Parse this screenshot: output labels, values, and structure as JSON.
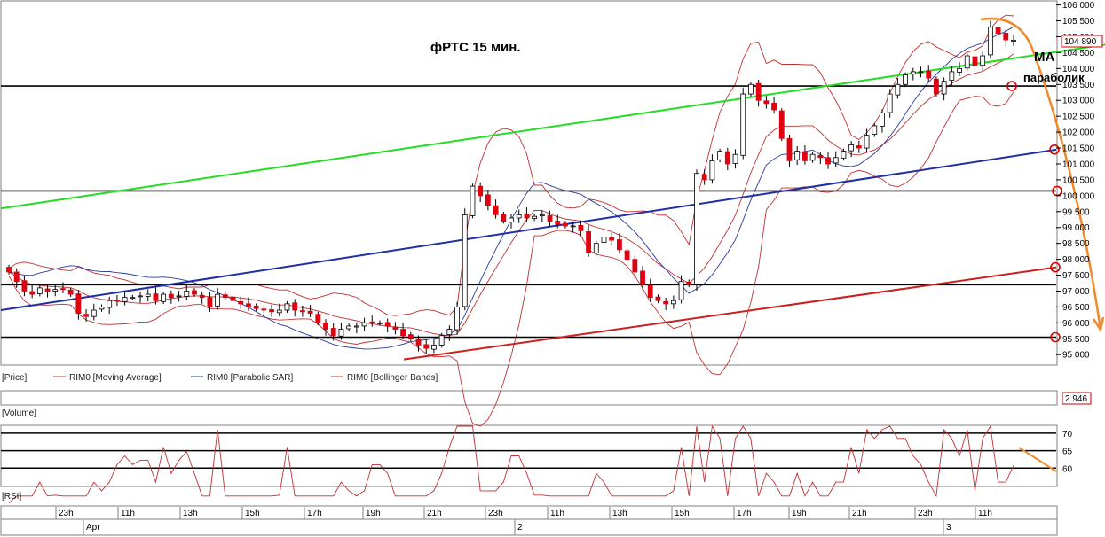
{
  "annotations": {
    "title": "фРТС   15 мин.",
    "ma": "МА",
    "parabolic": "параболик"
  },
  "price_panel": {
    "label": "[Price]",
    "legend": [
      {
        "text": "RIM0 [Moving Average]",
        "color": "#c0392b"
      },
      {
        "text": "RIM0 [Parabolic SAR]",
        "color": "#1f3fa8"
      },
      {
        "text": "RIM0 [Bollinger Bands]",
        "color": "#c0392b"
      }
    ],
    "last_price": "104 890"
  },
  "volume_panel": {
    "label": "[Volume]",
    "last_value": "2 946"
  },
  "rsi_panel": {
    "label": "[RSI]"
  },
  "colors": {
    "candle_up": "#ffffff",
    "candle_down": "#e0000f",
    "wick": "#000000",
    "green_trend": "#22dd22",
    "blue_trend": "#1f2fa8",
    "red_trend": "#cc1f1f",
    "orange_arrow": "#ee8a2a",
    "bb_red": "#c03030",
    "sar_blue": "#2a3a9a"
  },
  "chart_data": {
    "type": "candlestick",
    "ylim": [
      94700,
      106100
    ],
    "y_ticks": [
      "95 000",
      "95 500",
      "96 000",
      "96 500",
      "97 000",
      "97 500",
      "98 000",
      "98 500",
      "99 000",
      "99 500",
      "100 000",
      "100 500",
      "101 000",
      "101 500",
      "102 000",
      "102 500",
      "103 000",
      "103 500",
      "104 000",
      "104 500",
      "105 000",
      "105 500",
      "106 000"
    ],
    "y_tick_values": [
      95000,
      95500,
      96000,
      96500,
      97000,
      97500,
      98000,
      98500,
      99000,
      99500,
      100000,
      100500,
      101000,
      101500,
      102000,
      102500,
      103000,
      103500,
      104000,
      104500,
      105000,
      105500,
      106000
    ],
    "x_time_labels": [
      "23h",
      "11h",
      "13h",
      "15h",
      "17h",
      "19h",
      "21h",
      "23h",
      "11h",
      "13h",
      "15h",
      "17h",
      "19h",
      "21h",
      "23h",
      "11h"
    ],
    "x_date_labels": [
      "Apr",
      "2",
      "3"
    ],
    "horizontal_levels": [
      103450,
      100150,
      97200,
      95550
    ],
    "candles_close": [
      97600,
      97300,
      97000,
      96900,
      97100,
      97000,
      97050,
      97050,
      96900,
      96300,
      96200,
      96400,
      96500,
      96700,
      96700,
      96800,
      96800,
      96850,
      96900,
      96700,
      96900,
      96800,
      96850,
      97000,
      96900,
      96800,
      96500,
      96900,
      96800,
      96700,
      96600,
      96500,
      96450,
      96400,
      96350,
      96400,
      96600,
      96400,
      96350,
      96300,
      96000,
      95800,
      95600,
      95800,
      95900,
      95900,
      96000,
      96000,
      96000,
      95900,
      95800,
      95600,
      95500,
      95300,
      95200,
      95300,
      95600,
      95800,
      96500,
      99400,
      100300,
      100000,
      99700,
      99400,
      99200,
      99300,
      99400,
      99300,
      99350,
      99400,
      99200,
      99100,
      99050,
      99050,
      98900,
      98200,
      98500,
      98700,
      98600,
      98300,
      98000,
      97600,
      97200,
      96800,
      96700,
      96600,
      96700,
      97300,
      97200,
      100700,
      100500,
      101100,
      101400,
      101000,
      101300,
      103200,
      103500,
      103000,
      102900,
      102700,
      101800,
      101100,
      101400,
      101100,
      101300,
      101200,
      101000,
      101200,
      101400,
      101600,
      101500,
      101900,
      102200,
      102600,
      103200,
      103500,
      103800,
      103900,
      103900,
      103700,
      103200,
      103600,
      103900,
      104000,
      104400,
      104100,
      104400,
      105300,
      105100,
      104900,
      104890
    ],
    "rsi_ylim": [
      55,
      72
    ],
    "rsi_ticks": [
      60,
      65,
      70
    ],
    "rsi_levels": [
      70,
      65,
      60
    ]
  }
}
